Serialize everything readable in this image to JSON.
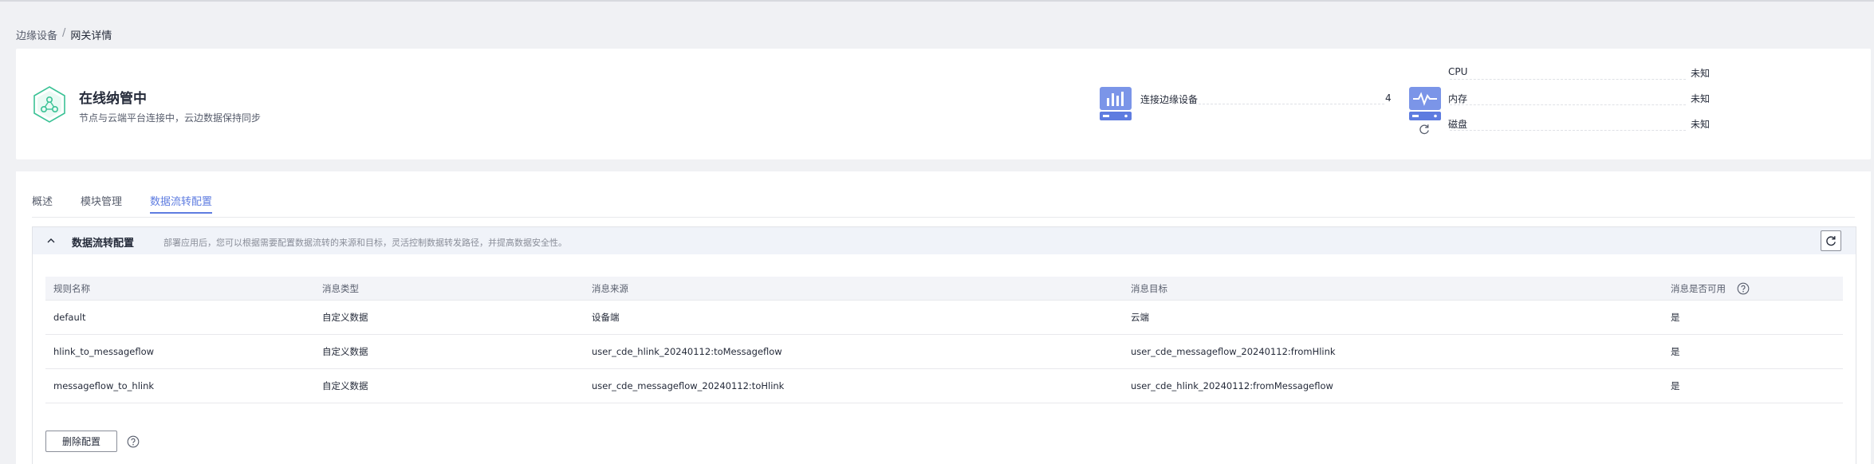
{
  "breadcrumb": {
    "parent": "边缘设备",
    "separator": "/",
    "current": "网关详情"
  },
  "status": {
    "title": "在线纳管中",
    "description": "节点与云端平台连接中，云边数据保持同步"
  },
  "devices": {
    "label": "连接边缘设备",
    "count": "4"
  },
  "resources": [
    {
      "label": "CPU",
      "value": "未知"
    },
    {
      "label": "内存",
      "value": "未知"
    },
    {
      "label": "磁盘",
      "value": "未知"
    }
  ],
  "tabs": [
    {
      "label": "概述"
    },
    {
      "label": "模块管理"
    },
    {
      "label": "数据流转配置"
    }
  ],
  "flow": {
    "title": "数据流转配置",
    "description": "部署应用后，您可以根据需要配置数据流转的来源和目标，灵活控制数据转发路径，并提高数据安全性。"
  },
  "table": {
    "headers": [
      "规则名称",
      "消息类型",
      "消息来源",
      "消息目标",
      "消息是否可用"
    ],
    "rows": [
      [
        "default",
        "自定义数据",
        "设备端",
        "云端",
        "是"
      ],
      [
        "hlink_to_messageflow",
        "自定义数据",
        "user_cde_hlink_20240112:toMessageflow",
        "user_cde_messageflow_20240112:fromHlink",
        "是"
      ],
      [
        "messageflow_to_hlink",
        "自定义数据",
        "user_cde_messageflow_20240112:toHlink",
        "user_cde_hlink_20240112:fromMessageflow",
        "是"
      ]
    ]
  },
  "actions": {
    "delete_label": "删除配置"
  },
  "colors": {
    "accent": "#5e7ce0",
    "status_green": "#3ac295",
    "icon_blue": "#7b95e8"
  },
  "icons": [
    "hexagon-status-icon",
    "device-chart-icon",
    "resource-monitor-icon",
    "refresh-icon",
    "chevron-up-icon",
    "help-icon"
  ]
}
